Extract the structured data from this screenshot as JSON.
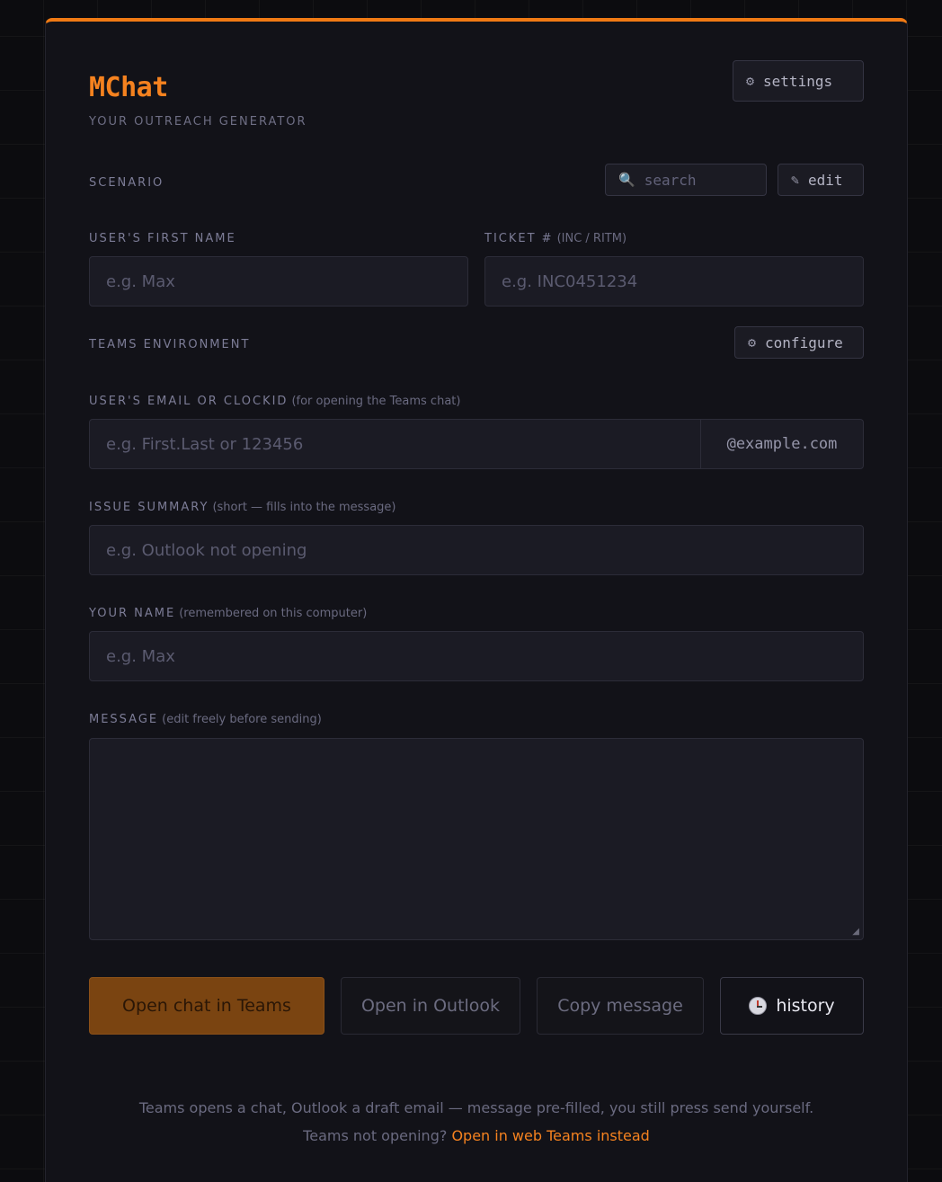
{
  "app": {
    "brand": "MChat",
    "tagline": "YOUR OUTREACH GENERATOR",
    "settings_label": "settings"
  },
  "scenario": {
    "label": "SCENARIO",
    "search_placeholder": "search",
    "edit_label": "edit"
  },
  "first_name": {
    "label": "USER'S FIRST NAME",
    "placeholder": "e.g. Max",
    "value": ""
  },
  "ticket": {
    "label": "TICKET #",
    "hint": "(INC / RITM)",
    "placeholder": "e.g. INC0451234",
    "value": ""
  },
  "teams_env": {
    "label": "TEAMS ENVIRONMENT",
    "configure_label": "configure"
  },
  "email": {
    "label": "USER'S EMAIL OR CLOCKID",
    "hint": "(for opening the Teams chat)",
    "placeholder": "e.g. First.Last or 123456",
    "suffix": "@example.com",
    "value": ""
  },
  "issue": {
    "label": "ISSUE SUMMARY",
    "hint": "(short — fills into the message)",
    "placeholder": "e.g. Outlook not opening",
    "value": ""
  },
  "your_name": {
    "label": "YOUR NAME",
    "hint": "(remembered on this computer)",
    "placeholder": "e.g. Max",
    "value": ""
  },
  "message": {
    "label": "MESSAGE",
    "hint": "(edit freely before sending)",
    "value": ""
  },
  "actions": {
    "teams": "Open chat in Teams",
    "outlook": "Open in Outlook",
    "copy": "Copy message",
    "history": "history"
  },
  "footer": {
    "line1": "Teams opens a chat, Outlook a draft email — message pre-filled, you still press send yourself.",
    "line2_prefix": "Teams not opening?",
    "line2_link": "Open in web Teams instead"
  },
  "colors": {
    "accent": "#f5821f",
    "primary_button": "#7a4411",
    "background": "#0c0c0f",
    "card": "#121218"
  },
  "icons": {
    "settings": "gear-icon",
    "search": "magnifier-icon",
    "edit": "pencil-icon",
    "configure": "gear-icon",
    "history": "clock-icon"
  }
}
